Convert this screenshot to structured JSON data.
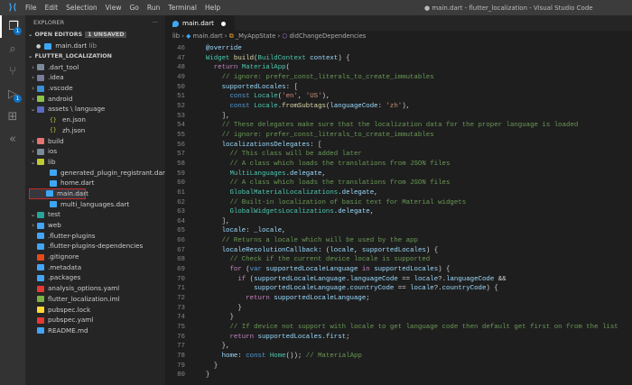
{
  "titlebar": {
    "menu": [
      "File",
      "Edit",
      "Selection",
      "View",
      "Go",
      "Run",
      "Terminal",
      "Help"
    ],
    "title": "● main.dart - flutter_localization - Visual Studio Code"
  },
  "activity": {
    "explorer_badge": "1",
    "debug_badge": "1"
  },
  "sidebar": {
    "header": "EXPLORER",
    "more": "···",
    "open_editors": "OPEN EDITORS",
    "unsaved": "1 UNSAVED",
    "open_file": "main.dart",
    "open_file_dir": "lib",
    "project": "FLUTTER_LOCALIZATION",
    "tree": [
      {
        "label": ".dart_tool",
        "depth": 0,
        "chev": "›",
        "color": "#7a8a99"
      },
      {
        "label": ".idea",
        "depth": 0,
        "chev": "›",
        "color": "#7a7a99"
      },
      {
        "label": ".vscode",
        "depth": 0,
        "chev": "›",
        "color": "#3a8fd6"
      },
      {
        "label": "android",
        "depth": 0,
        "chev": "›",
        "color": "#8bc34a"
      },
      {
        "label": "assets \\ language",
        "depth": 0,
        "chev": "⌄",
        "color": "#5c6bc0"
      },
      {
        "label": "en.json",
        "depth": 1,
        "chev": "",
        "color": "#cbcb41",
        "glyph": "{}"
      },
      {
        "label": "zh.json",
        "depth": 1,
        "chev": "",
        "color": "#cbcb41",
        "glyph": "{}"
      },
      {
        "label": "build",
        "depth": 0,
        "chev": "›",
        "color": "#e57373"
      },
      {
        "label": "ios",
        "depth": 0,
        "chev": "›",
        "color": "#7a8a99"
      },
      {
        "label": "lib",
        "depth": 0,
        "chev": "⌄",
        "color": "#c0ca33"
      },
      {
        "label": "generated_plugin_registrant.dart",
        "depth": 1,
        "chev": "",
        "color": "#3ea6f3",
        "dart": true
      },
      {
        "label": "home.dart",
        "depth": 1,
        "chev": "",
        "color": "#3ea6f3",
        "dart": true
      },
      {
        "label": "main.dart",
        "depth": 1,
        "chev": "",
        "color": "#3ea6f3",
        "dart": true,
        "selected": true
      },
      {
        "label": "multi_languages.dart",
        "depth": 1,
        "chev": "",
        "color": "#3ea6f3",
        "dart": true
      },
      {
        "label": "test",
        "depth": 0,
        "chev": "⌄",
        "color": "#26a69a"
      },
      {
        "label": "web",
        "depth": 0,
        "chev": "›",
        "color": "#42a5f5"
      },
      {
        "label": ".flutter-plugins",
        "depth": 0,
        "chev": "",
        "color": "#42a5f5"
      },
      {
        "label": ".flutter-plugins-dependencies",
        "depth": 0,
        "chev": "",
        "color": "#42a5f5"
      },
      {
        "label": ".gitignore",
        "depth": 0,
        "chev": "",
        "color": "#e64a19"
      },
      {
        "label": ".metadata",
        "depth": 0,
        "chev": "",
        "color": "#42a5f5"
      },
      {
        "label": ".packages",
        "depth": 0,
        "chev": "",
        "color": "#42a5f5"
      },
      {
        "label": "analysis_options.yaml",
        "depth": 0,
        "chev": "",
        "color": "#e53935"
      },
      {
        "label": "flutter_localization.iml",
        "depth": 0,
        "chev": "",
        "color": "#7cb342"
      },
      {
        "label": "pubspec.lock",
        "depth": 0,
        "chev": "",
        "color": "#fdd835"
      },
      {
        "label": "pubspec.yaml",
        "depth": 0,
        "chev": "",
        "color": "#e53935"
      },
      {
        "label": "README.md",
        "depth": 0,
        "chev": "",
        "color": "#42a5f5"
      }
    ]
  },
  "editor": {
    "tab": "main.dart",
    "breadcrumb": [
      "lib",
      "main.dart",
      "_MyAppState",
      "didChangeDependencies"
    ],
    "lines": [
      [
        46,
        [
          [
            "va",
            "  @override"
          ]
        ]
      ],
      [
        47,
        [
          [
            "ty",
            "  Widget "
          ],
          [
            "fn",
            "build"
          ],
          [
            "p",
            "("
          ],
          [
            "ty",
            "BuildContext "
          ],
          [
            "va",
            "context"
          ],
          [
            "p",
            ") {"
          ]
        ]
      ],
      [
        48,
        [
          [
            "kw",
            "    return "
          ],
          [
            "ty",
            "MaterialApp"
          ],
          [
            "p",
            "("
          ]
        ]
      ],
      [
        49,
        [
          [
            "cm",
            "      // ignore: prefer_const_literals_to_create_immutables"
          ]
        ]
      ],
      [
        50,
        [
          [
            "va",
            "      supportedLocales"
          ],
          [
            "p",
            ": ["
          ]
        ]
      ],
      [
        51,
        [
          [
            "k2",
            "        const "
          ],
          [
            "ty",
            "Locale"
          ],
          [
            "p",
            "("
          ],
          [
            "st",
            "'en'"
          ],
          [
            "p",
            ", "
          ],
          [
            "st",
            "'US'"
          ],
          [
            "p",
            "),"
          ]
        ]
      ],
      [
        52,
        [
          [
            "k2",
            "        const "
          ],
          [
            "ty",
            "Locale"
          ],
          [
            "p",
            "."
          ],
          [
            "fn",
            "fromSubtags"
          ],
          [
            "p",
            "("
          ],
          [
            "va",
            "languageCode"
          ],
          [
            "p",
            ": "
          ],
          [
            "st",
            "'zh'"
          ],
          [
            "p",
            "),"
          ]
        ]
      ],
      [
        53,
        [
          [
            "p",
            "      ],"
          ]
        ]
      ],
      [
        54,
        [
          [
            "cm",
            "      // These delegates make sure that the localization data for the proper language is loaded"
          ]
        ]
      ],
      [
        55,
        [
          [
            "cm",
            "      // ignore: prefer_const_literals_to_create_immutables"
          ]
        ]
      ],
      [
        56,
        [
          [
            "va",
            "      localizationsDelegates"
          ],
          [
            "p",
            ": ["
          ]
        ]
      ],
      [
        57,
        [
          [
            "cm",
            "        // This class will be added later"
          ]
        ]
      ],
      [
        58,
        [
          [
            "cm",
            "        // A class which loads the translations from JSON files"
          ]
        ]
      ],
      [
        59,
        [
          [
            "ty",
            "        MultiLanguages"
          ],
          [
            "p",
            "."
          ],
          [
            "va",
            "delegate"
          ],
          [
            "p",
            ","
          ]
        ]
      ],
      [
        60,
        [
          [
            "cm",
            "        // A class which loads the translations from JSON files"
          ]
        ]
      ],
      [
        61,
        [
          [
            "ty",
            "        GlobalMaterialLocalizations"
          ],
          [
            "p",
            "."
          ],
          [
            "va",
            "delegate"
          ],
          [
            "p",
            ","
          ]
        ]
      ],
      [
        62,
        [
          [
            "cm",
            "        // Built-in localization of basic text for Material widgets"
          ]
        ]
      ],
      [
        63,
        [
          [
            "ty",
            "        GlobalWidgetsLocalizations"
          ],
          [
            "p",
            "."
          ],
          [
            "va",
            "delegate"
          ],
          [
            "p",
            ","
          ]
        ]
      ],
      [
        64,
        [
          [
            "p",
            "      ],"
          ]
        ]
      ],
      [
        65,
        [
          [
            "va",
            "      locale"
          ],
          [
            "p",
            ": "
          ],
          [
            "va",
            "_locale"
          ],
          [
            "p",
            ","
          ]
        ]
      ],
      [
        66,
        [
          [
            "cm",
            "      // Returns a locale which will be used by the app"
          ]
        ]
      ],
      [
        67,
        [
          [
            "va",
            "      localeResolutionCallback"
          ],
          [
            "p",
            ": ("
          ],
          [
            "va",
            "locale"
          ],
          [
            "p",
            ", "
          ],
          [
            "va",
            "supportedLocales"
          ],
          [
            "p",
            ") {"
          ]
        ]
      ],
      [
        68,
        [
          [
            "cm",
            "        // Check if the current device locale is supported"
          ]
        ]
      ],
      [
        69,
        [
          [
            "kw",
            "        for "
          ],
          [
            "p",
            "("
          ],
          [
            "k2",
            "var "
          ],
          [
            "va",
            "supportedLocaleLanguage "
          ],
          [
            "kw",
            "in "
          ],
          [
            "va",
            "supportedLocales"
          ],
          [
            "p",
            ") {"
          ]
        ]
      ],
      [
        70,
        [
          [
            "kw",
            "          if "
          ],
          [
            "p",
            "("
          ],
          [
            "va",
            "supportedLocaleLanguage"
          ],
          [
            "p",
            "."
          ],
          [
            "va",
            "languageCode"
          ],
          [
            "p",
            " == "
          ],
          [
            "va",
            "locale"
          ],
          [
            "p",
            "?."
          ],
          [
            "va",
            "languageCode"
          ],
          [
            "p",
            " &&"
          ]
        ]
      ],
      [
        71,
        [
          [
            "va",
            "              supportedLocaleLanguage"
          ],
          [
            "p",
            "."
          ],
          [
            "va",
            "countryCode"
          ],
          [
            "p",
            " == "
          ],
          [
            "va",
            "locale"
          ],
          [
            "p",
            "?."
          ],
          [
            "va",
            "countryCode"
          ],
          [
            "p",
            ") {"
          ]
        ]
      ],
      [
        72,
        [
          [
            "kw",
            "            return "
          ],
          [
            "va",
            "supportedLocaleLanguage"
          ],
          [
            "p",
            ";"
          ]
        ]
      ],
      [
        73,
        [
          [
            "p",
            "          }"
          ]
        ]
      ],
      [
        74,
        [
          [
            "p",
            "        }"
          ]
        ]
      ],
      [
        75,
        [
          [
            "cm",
            "        // If device not support with locale to get language code then default get first on from the list"
          ]
        ]
      ],
      [
        76,
        [
          [
            "kw",
            "        return "
          ],
          [
            "va",
            "supportedLocales"
          ],
          [
            "p",
            "."
          ],
          [
            "va",
            "first"
          ],
          [
            "p",
            ";"
          ]
        ]
      ],
      [
        77,
        [
          [
            "p",
            "      },"
          ]
        ]
      ],
      [
        78,
        [
          [
            "va",
            "      home"
          ],
          [
            "p",
            ": "
          ],
          [
            "k2",
            "const "
          ],
          [
            "ty",
            "Home"
          ],
          [
            "p",
            "()); "
          ],
          [
            "cm",
            "// MaterialApp"
          ]
        ]
      ],
      [
        79,
        [
          [
            "p",
            "    }"
          ]
        ]
      ],
      [
        80,
        [
          [
            "p",
            "  }"
          ]
        ]
      ]
    ]
  }
}
